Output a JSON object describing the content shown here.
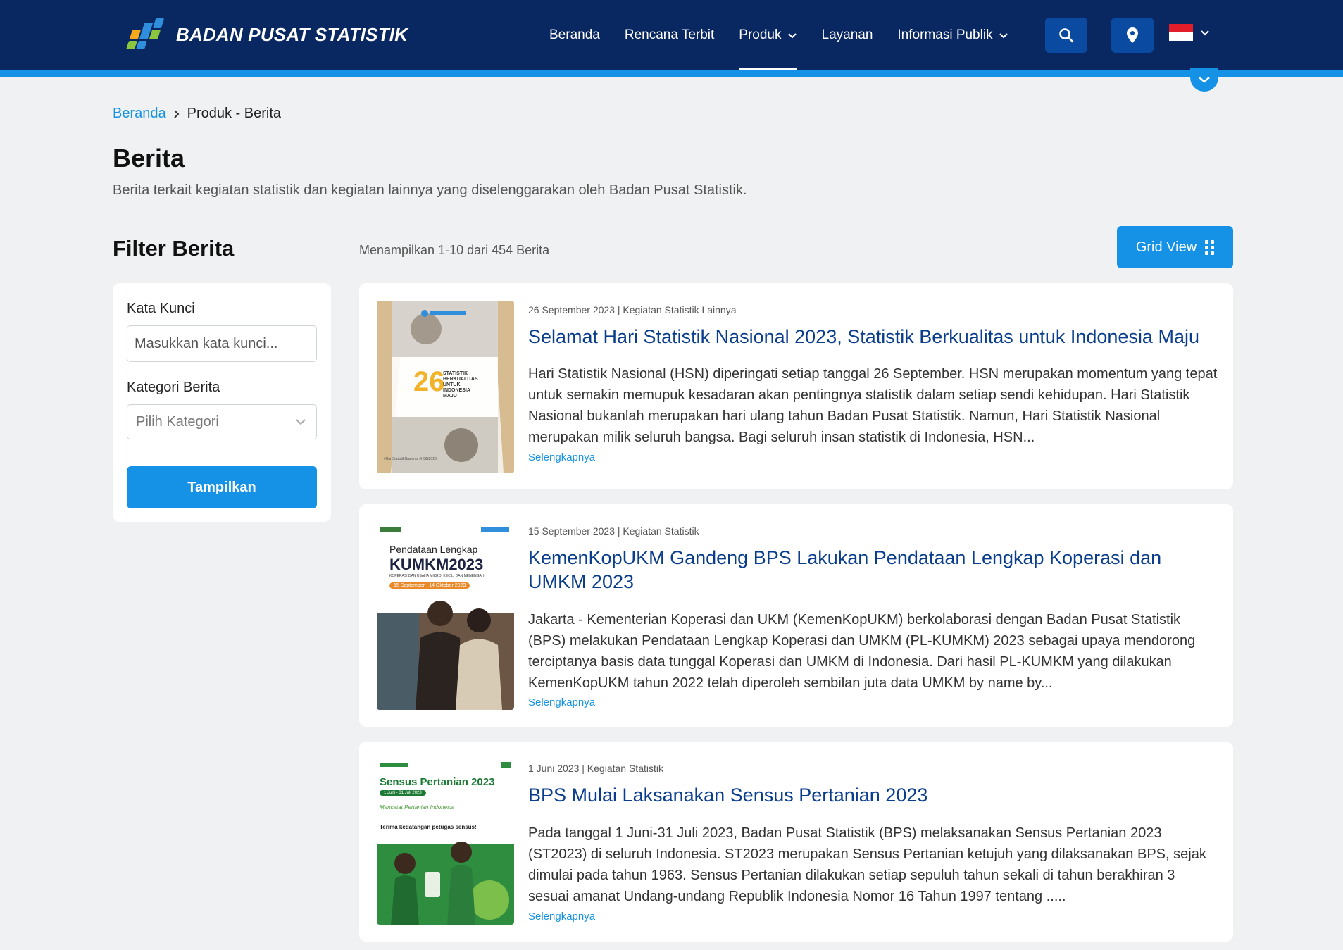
{
  "header": {
    "logo_text": "BADAN PUSAT STATISTIK",
    "nav": [
      {
        "label": "Beranda",
        "has_dropdown": false,
        "active": false
      },
      {
        "label": "Rencana Terbit",
        "has_dropdown": false,
        "active": false
      },
      {
        "label": "Produk",
        "has_dropdown": true,
        "active": true
      },
      {
        "label": "Layanan",
        "has_dropdown": false,
        "active": false
      },
      {
        "label": "Informasi Publik",
        "has_dropdown": true,
        "active": false
      }
    ],
    "colors": {
      "bar": "#092862",
      "stripe": "#1592e6",
      "icon_button": "#0a4aa0"
    },
    "icons": [
      "search-icon",
      "location-pin-icon",
      "indonesia-flag-icon",
      "chevron-down-icon"
    ]
  },
  "breadcrumb": {
    "home": "Beranda",
    "current": "Produk - Berita"
  },
  "page": {
    "title": "Berita",
    "description": "Berita terkait kegiatan statistik dan kegiatan lainnya yang diselenggarakan oleh Badan Pusat Statistik."
  },
  "filter": {
    "title": "Filter Berita",
    "keyword_label": "Kata Kunci",
    "keyword_placeholder": "Masukkan kata kunci...",
    "keyword_value": "",
    "category_label": "Kategori Berita",
    "category_placeholder": "Pilih Kategori",
    "submit_label": "Tampilkan"
  },
  "results": {
    "count_text": "Menampilkan 1-10 dari 454 Berita",
    "view_toggle_label": "Grid View"
  },
  "news": [
    {
      "meta": "26 September 2023 | Kegiatan Statistik Lainnya",
      "title": "Selamat Hari Statistik Nasional 2023, Statistik Berkualitas untuk Indonesia Maju",
      "body": "Hari Statistik Nasional (HSN) diperingati setiap tanggal 26 September. HSN merupakan momentum yang tepat untuk semakin memupuk kesadaran akan pentingnya statistik dalam setiap sendi kehidupan. Hari Statistik Nasional bukanlah merupakan hari ulang tahun Badan Pusat Statistik. Namun, Hari Statistik Nasional merupakan milik seluruh bangsa. Bagi seluruh insan statistik di Indonesia, HSN...",
      "more": "Selengkapnya",
      "thumb_text": {
        "number": "26",
        "caption": "STATISTIK BERKUALITAS UNTUK INDONESIA MAJU",
        "tag": "#HariStatistikNasional #HSN2023"
      }
    },
    {
      "meta": "15 September 2023 | Kegiatan Statistik",
      "title": "KemenKopUKM Gandeng BPS Lakukan Pendataan Lengkap Koperasi dan UMKM 2023",
      "body": "Jakarta - Kementerian Koperasi dan UKM (KemenKopUKM) berkolaborasi dengan Badan Pusat Statistik (BPS) melakukan Pendataan Lengkap Koperasi dan UMKM (PL-KUMKM) 2023 sebagai upaya mendorong terciptanya basis data tunggal Koperasi dan UMKM di Indonesia. Dari hasil PL-KUMKM yang dilakukan KemenKopUKM tahun 2022 telah diperoleh sembilan juta data UMKM by name by...",
      "more": "Selengkapnya",
      "thumb_text": {
        "line1": "Pendataan Lengkap",
        "line2": "KUMKM2023",
        "line3": "KOPERASI DAN USAHA MIKRO, KECIL, DAN MENENGAH",
        "dates": "15 September - 14 Oktober 2023"
      }
    },
    {
      "meta": "1 Juni 2023 | Kegiatan Statistik",
      "title": "BPS Mulai Laksanakan Sensus Pertanian 2023",
      "body": "Pada tanggal 1 Juni-31 Juli 2023, Badan Pusat Statistik (BPS) melaksanakan Sensus Pertanian 2023 (ST2023) di seluruh Indonesia. ST2023 merupakan Sensus Pertanian ketujuh yang dilaksanakan BPS, sejak dimulai pada tahun 1963. Sensus Pertanian dilakukan setiap sepuluh tahun sekali di tahun berakhiran 3 sesuai amanat Undang-undang Republik Indonesia Nomor 16 Tahun 1997 tentang .....",
      "more": "Selengkapnya",
      "thumb_text": {
        "line1": "Sensus Pertanian 2023",
        "dates": "1 Juni - 31 Juli 2023",
        "line2": "Mencatat Pertanian Indonesia",
        "line3": "Terima kedatangan petugas sensus!"
      }
    }
  ]
}
